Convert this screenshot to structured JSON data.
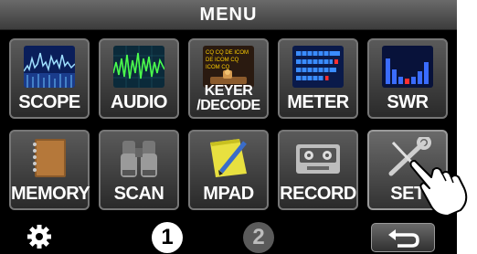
{
  "header": {
    "title": "MENU"
  },
  "tiles": [
    {
      "label": "SCOPE",
      "icon": "scope-spectrum-icon"
    },
    {
      "label": "AUDIO",
      "icon": "audio-scope-icon"
    },
    {
      "label": "KEYER\n/DECODE",
      "label_line1": "KEYER",
      "label_line2": "/DECODE",
      "icon": "keyer-decode-icon",
      "icon_text": [
        "CQ CQ DE ICOM",
        "DE ICOM CQ",
        "ICOM CQ"
      ]
    },
    {
      "label": "METER",
      "icon": "meter-icon"
    },
    {
      "label": "SWR",
      "icon": "swr-graph-icon"
    },
    {
      "label": "MEMORY",
      "icon": "memory-book-icon"
    },
    {
      "label": "SCAN",
      "icon": "binoculars-icon"
    },
    {
      "label": "MPAD",
      "icon": "memo-pad-icon"
    },
    {
      "label": "RECORD",
      "icon": "recorder-icon"
    },
    {
      "label": "SET",
      "icon": "wrench-screwdriver-icon",
      "selected": true
    }
  ],
  "footer": {
    "pages": [
      "1",
      "2"
    ],
    "current_page": "1",
    "gear_icon": "gear-icon",
    "back_icon": "return-arrow-icon"
  },
  "colors": {
    "background": "#000000",
    "tile": "#444444",
    "label": "#ffffff",
    "page_active": "#ffffff",
    "page_inactive": "#5a5a5a"
  }
}
